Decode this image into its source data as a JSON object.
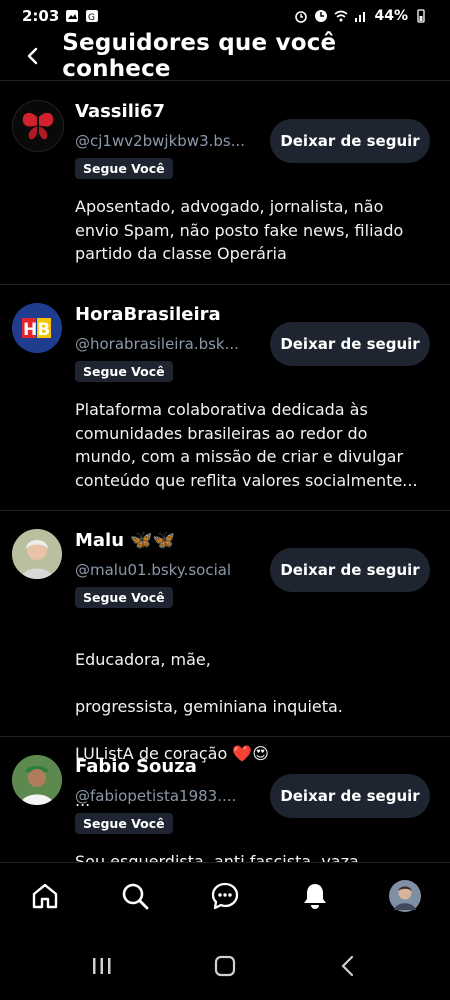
{
  "status": {
    "time": "2:03",
    "battery": "44%"
  },
  "header": {
    "title": "Seguidores que você conhece"
  },
  "users": [
    {
      "name": "Vassili67",
      "handle": "@cj1wv2bwjkbw3.bs...",
      "badge": "Segue Você",
      "button": "Deixar de seguir",
      "bio": "Aposentado, advogado, jornalista, não\nenvio Spam, não posto fake news,  filiado\npartido da classe Operária"
    },
    {
      "name": "HoraBrasileira",
      "handle": "@horabrasileira.bsk...",
      "badge": "Segue Você",
      "button": "Deixar de seguir",
      "avatar_text": "HB",
      "bio": "Plataforma colaborativa dedicada às\ncomunidades brasileiras ao redor do\nmundo, com a missão de criar e divulgar\nconteúdo que reflita valores socialmente..."
    },
    {
      "name": "Malu 🦋🦋",
      "handle": "@malu01.bsky.social",
      "badge": "Segue Você",
      "button": "Deixar de seguir",
      "bio_line1": "Educadora, mãe,",
      "bio_line2": "progressista, geminiana inquieta.",
      "bio_line3": "LUListA de coração",
      "bio_line3_emojis": "❤️😍",
      "bio_line4": "..."
    },
    {
      "name": "Fabio Souza",
      "handle": "@fabiopetista1983....",
      "badge": "Segue Você",
      "button": "Deixar de seguir",
      "bio": "Sou esquerdista, anti fascista, vaza..."
    }
  ],
  "colors": {
    "accent_badge": "#1e2530",
    "handle": "#8b98a8",
    "divider": "#1c1f24"
  },
  "nav": [
    "home-icon",
    "search-icon",
    "chat-icon",
    "bell-icon",
    "profile-avatar"
  ],
  "system_nav": [
    "recents-icon",
    "home-icon",
    "back-icon"
  ]
}
